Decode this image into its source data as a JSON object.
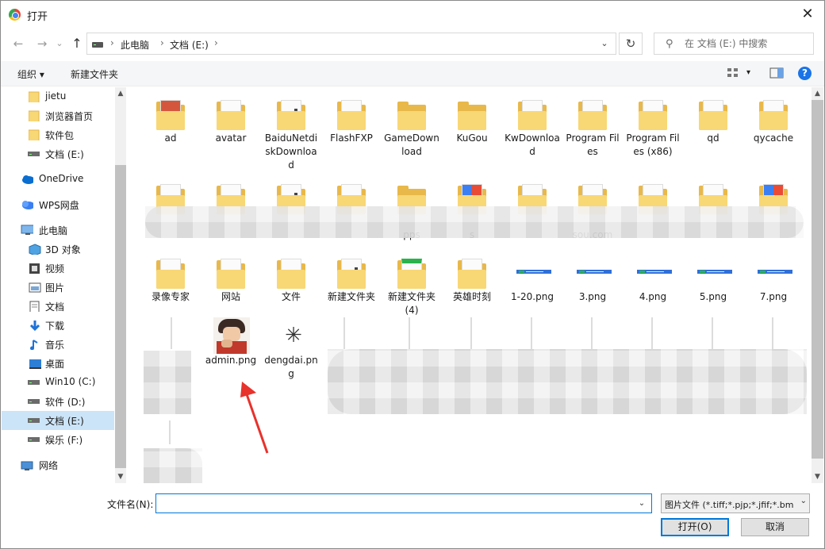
{
  "window": {
    "title": "打开",
    "close_label": "✕"
  },
  "nav": {
    "back": "←",
    "forward": "→",
    "recent": "⌄",
    "up": "↑",
    "breadcrumb": [
      "此电脑",
      "文档 (E:)"
    ],
    "breadcrumb_sep": "›",
    "dropdown": "⌄",
    "refresh": "↻",
    "search_placeholder": "在 文档 (E:) 中搜索"
  },
  "toolbar": {
    "organize": "组织 ▾",
    "new_folder": "新建文件夹",
    "view_drop": "▾",
    "help": "?"
  },
  "sidebar": {
    "items": [
      {
        "label": "jietu",
        "icon": "folder-icon"
      },
      {
        "label": "浏览器首页",
        "icon": "folder-icon"
      },
      {
        "label": "软件包",
        "icon": "folder-icon"
      },
      {
        "label": "文档 (E:)",
        "icon": "drive-icon"
      },
      {
        "label": "OneDrive",
        "icon": "cloud-icon"
      },
      {
        "label": "WPS网盘",
        "icon": "wps-cloud-icon"
      },
      {
        "label": "此电脑",
        "icon": "computer-icon"
      },
      {
        "label": "3D 对象",
        "icon": "3d-objects-icon"
      },
      {
        "label": "视频",
        "icon": "video-icon"
      },
      {
        "label": "图片",
        "icon": "pictures-icon"
      },
      {
        "label": "文档",
        "icon": "documents-icon"
      },
      {
        "label": "下载",
        "icon": "download-icon"
      },
      {
        "label": "音乐",
        "icon": "music-icon"
      },
      {
        "label": "桌面",
        "icon": "desktop-icon"
      },
      {
        "label": "Win10 (C:)",
        "icon": "drive-icon"
      },
      {
        "label": "软件 (D:)",
        "icon": "drive-icon"
      },
      {
        "label": "文档 (E:)",
        "icon": "drive-icon"
      },
      {
        "label": "娱乐 (F:)",
        "icon": "drive-icon"
      },
      {
        "label": "网络",
        "icon": "network-icon"
      }
    ],
    "selected": "文档 (E:)"
  },
  "files": {
    "row1": [
      "ad",
      "avatar",
      "BaiduNetdiskDownload",
      "FlashFXP",
      "GameDownload",
      "KuGou",
      "KwDownload",
      "Program Files",
      "Program Files (x86)",
      "qd",
      "qycache"
    ],
    "row2_visible": [
      "pps",
      "s",
      "sou.com"
    ],
    "row3": [
      "录像专家",
      "网站",
      "文件",
      "新建文件夹",
      "新建文件夹 (4)",
      "英雄时刻",
      "1-20.png",
      "3.png",
      "4.png",
      "5.png",
      "7.png"
    ],
    "row4": [
      "admin.png",
      "dengdai.png"
    ]
  },
  "bottom": {
    "filename_label": "文件名(N):",
    "filename_value": "",
    "filter": "图片文件 (*.tiff;*.pjp;*.jfif;*.bm",
    "filter_drop": "⌄",
    "open": "打开(O)",
    "cancel": "取消"
  },
  "colors": {
    "accent": "#0078d7",
    "selected": "#cce4f7",
    "folder": "#f8d775",
    "annotation_arrow": "#e8322c"
  }
}
